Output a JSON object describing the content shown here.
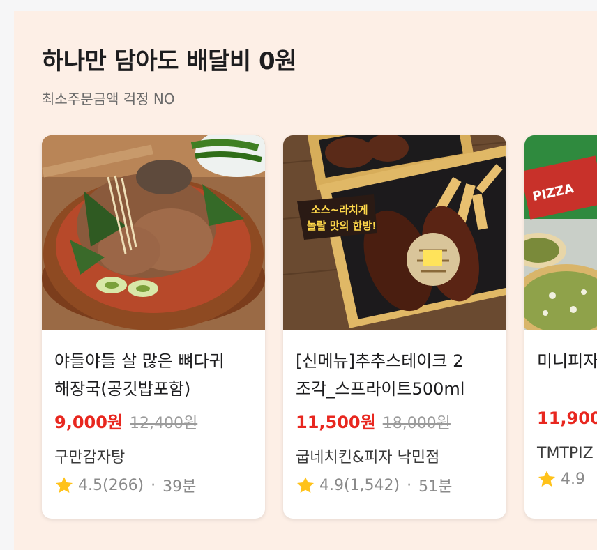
{
  "section": {
    "title": "하나만 담아도 배달비 0원",
    "subtitle": "최소주문금액 걱정 NO"
  },
  "cards": [
    {
      "name": "야들야들 살 많은 뼈다귀\n해장국(공깃밥포함)",
      "price": "9,000원",
      "original_price": "12,400원",
      "store": "구만감자탕",
      "rating": "4.5(266)",
      "dot": "·",
      "time": "39분"
    },
    {
      "name": "[신메뉴]추추스테이크 2\n조각_스프라이트500ml",
      "price": "11,500원",
      "original_price": "18,000원",
      "store": "굽네치킨&피자 낙민점",
      "rating": "4.9(1,542)",
      "dot": "·",
      "time": "51분",
      "image_badge": [
        "소스~라치게",
        "놀랄 맛의 한방!"
      ]
    },
    {
      "name": "미니피자",
      "price": "11,900",
      "original_price": "",
      "store": "TMTPIZ",
      "rating": "4.9",
      "dot": "",
      "time": "",
      "image_text": "PIZZA"
    }
  ],
  "colors": {
    "section_bg": "#fdefe6",
    "price_red": "#e8271f",
    "star_yellow": "#ffc21a"
  }
}
